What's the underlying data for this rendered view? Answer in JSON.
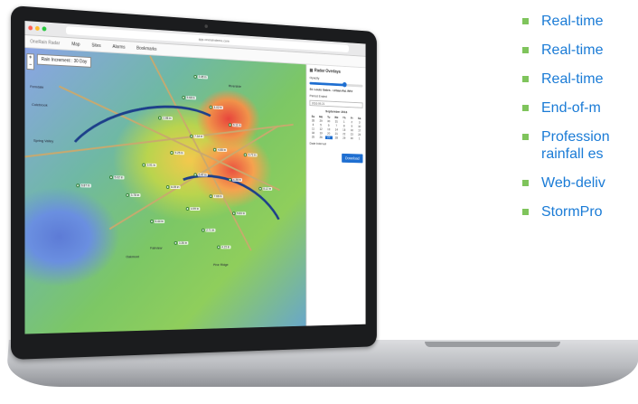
{
  "browser": {
    "url": "app.oneraindemo.com"
  },
  "app": {
    "brand": "OneRain Radar",
    "nav": [
      "Map",
      "Sites",
      "Alarms",
      "Bookmarks"
    ]
  },
  "map": {
    "overlay_button": "Rain Increment : 30 Day",
    "zoom_in": "+",
    "zoom_out": "−",
    "cities": [
      "Ferndale",
      "Colebrook",
      "Spring Valley",
      "Oakmont",
      "Fairview",
      "Riverside",
      "Pine Ridge"
    ],
    "gauges": [
      "3.45 in",
      "5.68 in",
      "4.02 in",
      "2.98 in",
      "6.11 in",
      "7.34 in",
      "5.25 in",
      "4.88 in",
      "6.72 in",
      "3.91 in",
      "5.47 in",
      "4.36 in",
      "6.05 in",
      "8.12 in",
      "7.66 in",
      "3.78 in",
      "4.99 in",
      "5.83 in",
      "6.44 in",
      "2.71 in",
      "3.36 in",
      "4.15 in",
      "5.02 in",
      "6.87 in"
    ]
  },
  "panel": {
    "title": "Radar Overlays",
    "opacity_label": "Opacity",
    "opacity_value": 0.65,
    "location": "St. Louis Gates - Urban Rd. RF#",
    "period_label": "Period Ended",
    "period_value": "2016-09-21",
    "calendar_title": "September 2016",
    "weekdays": [
      "Su",
      "Mo",
      "Tu",
      "We",
      "Th",
      "Fr",
      "Sa"
    ],
    "days": [
      "28",
      "29",
      "30",
      "31",
      "1",
      "2",
      "3",
      "4",
      "5",
      "6",
      "7",
      "8",
      "9",
      "10",
      "11",
      "12",
      "13",
      "14",
      "15",
      "16",
      "17",
      "18",
      "19",
      "20",
      "21",
      "22",
      "23",
      "24",
      "25",
      "26",
      "27",
      "28",
      "29",
      "30",
      "1"
    ],
    "selected_day": "27",
    "date_range": "Date Interval",
    "download": "Download"
  },
  "features": [
    {
      "label": "Real-time"
    },
    {
      "label": "Real-time"
    },
    {
      "label": "Real-time"
    },
    {
      "label": "End-of-m"
    },
    {
      "label": "Profession\nrainfall es"
    },
    {
      "label": "Web-deliv"
    },
    {
      "label": "StormPro"
    }
  ],
  "colors": {
    "accent": "#1a7bd6",
    "bullet": "#7fc45c",
    "button": "#1f6fd1"
  }
}
